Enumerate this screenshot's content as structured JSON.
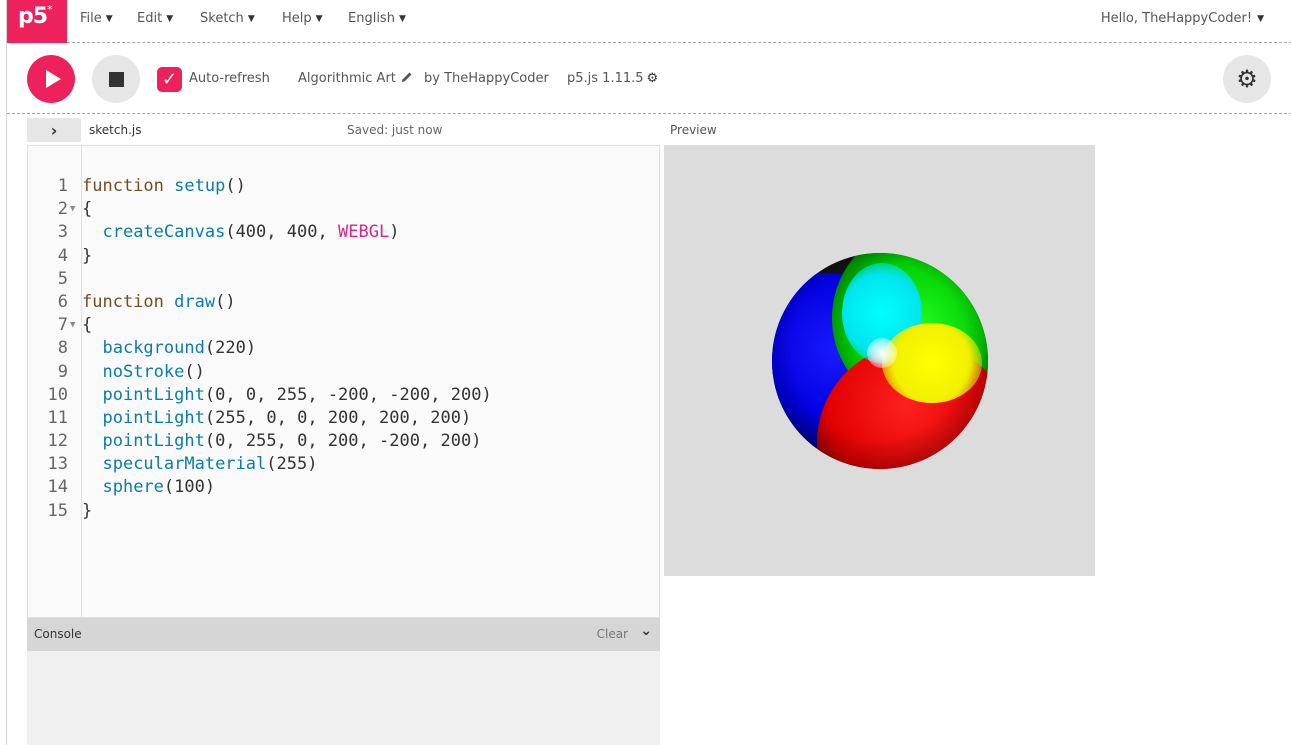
{
  "menubar": {
    "logo": "p5",
    "logo_sup": "*",
    "items": [
      {
        "label": "File"
      },
      {
        "label": "Edit"
      },
      {
        "label": "Sketch"
      },
      {
        "label": "Help"
      },
      {
        "label": "English"
      }
    ],
    "user": "Hello, TheHappyCoder!"
  },
  "toolbar": {
    "auto_refresh_label": "Auto-refresh",
    "auto_refresh_checked": true,
    "sketch_name": "Algorithmic Art",
    "author": "by TheHappyCoder",
    "version": "p5.js 1.11.5"
  },
  "editor": {
    "filename": "sketch.js",
    "saved_status": "Saved: just now",
    "lines": [
      {
        "n": "1",
        "fold": "",
        "code": "function setup()"
      },
      {
        "n": "2",
        "fold": "▼",
        "code": "{"
      },
      {
        "n": "3",
        "fold": "",
        "code": "  createCanvas(400, 400, WEBGL)"
      },
      {
        "n": "4",
        "fold": "",
        "code": "}"
      },
      {
        "n": "5",
        "fold": "",
        "code": ""
      },
      {
        "n": "6",
        "fold": "",
        "code": "function draw()"
      },
      {
        "n": "7",
        "fold": "▼",
        "code": "{"
      },
      {
        "n": "8",
        "fold": "",
        "code": "  background(220)"
      },
      {
        "n": "9",
        "fold": "",
        "code": "  noStroke()"
      },
      {
        "n": "10",
        "fold": "",
        "code": "  pointLight(0, 0, 255, -200, -200, 200)"
      },
      {
        "n": "11",
        "fold": "",
        "code": "  pointLight(255, 0, 0, 200, 200, 200)"
      },
      {
        "n": "12",
        "fold": "",
        "code": "  pointLight(0, 255, 0, 200, -200, 200)"
      },
      {
        "n": "13",
        "fold": "",
        "code": "  specularMaterial(255)"
      },
      {
        "n": "14",
        "fold": "",
        "code": "  sphere(100)"
      },
      {
        "n": "15",
        "fold": "",
        "code": "}"
      }
    ]
  },
  "console": {
    "title": "Console",
    "clear_label": "Clear"
  },
  "preview": {
    "label": "Preview"
  },
  "colors": {
    "accent": "#ed225d",
    "keyword": "#704f21",
    "function": "#0b7ca9",
    "constant": "#d52889"
  }
}
